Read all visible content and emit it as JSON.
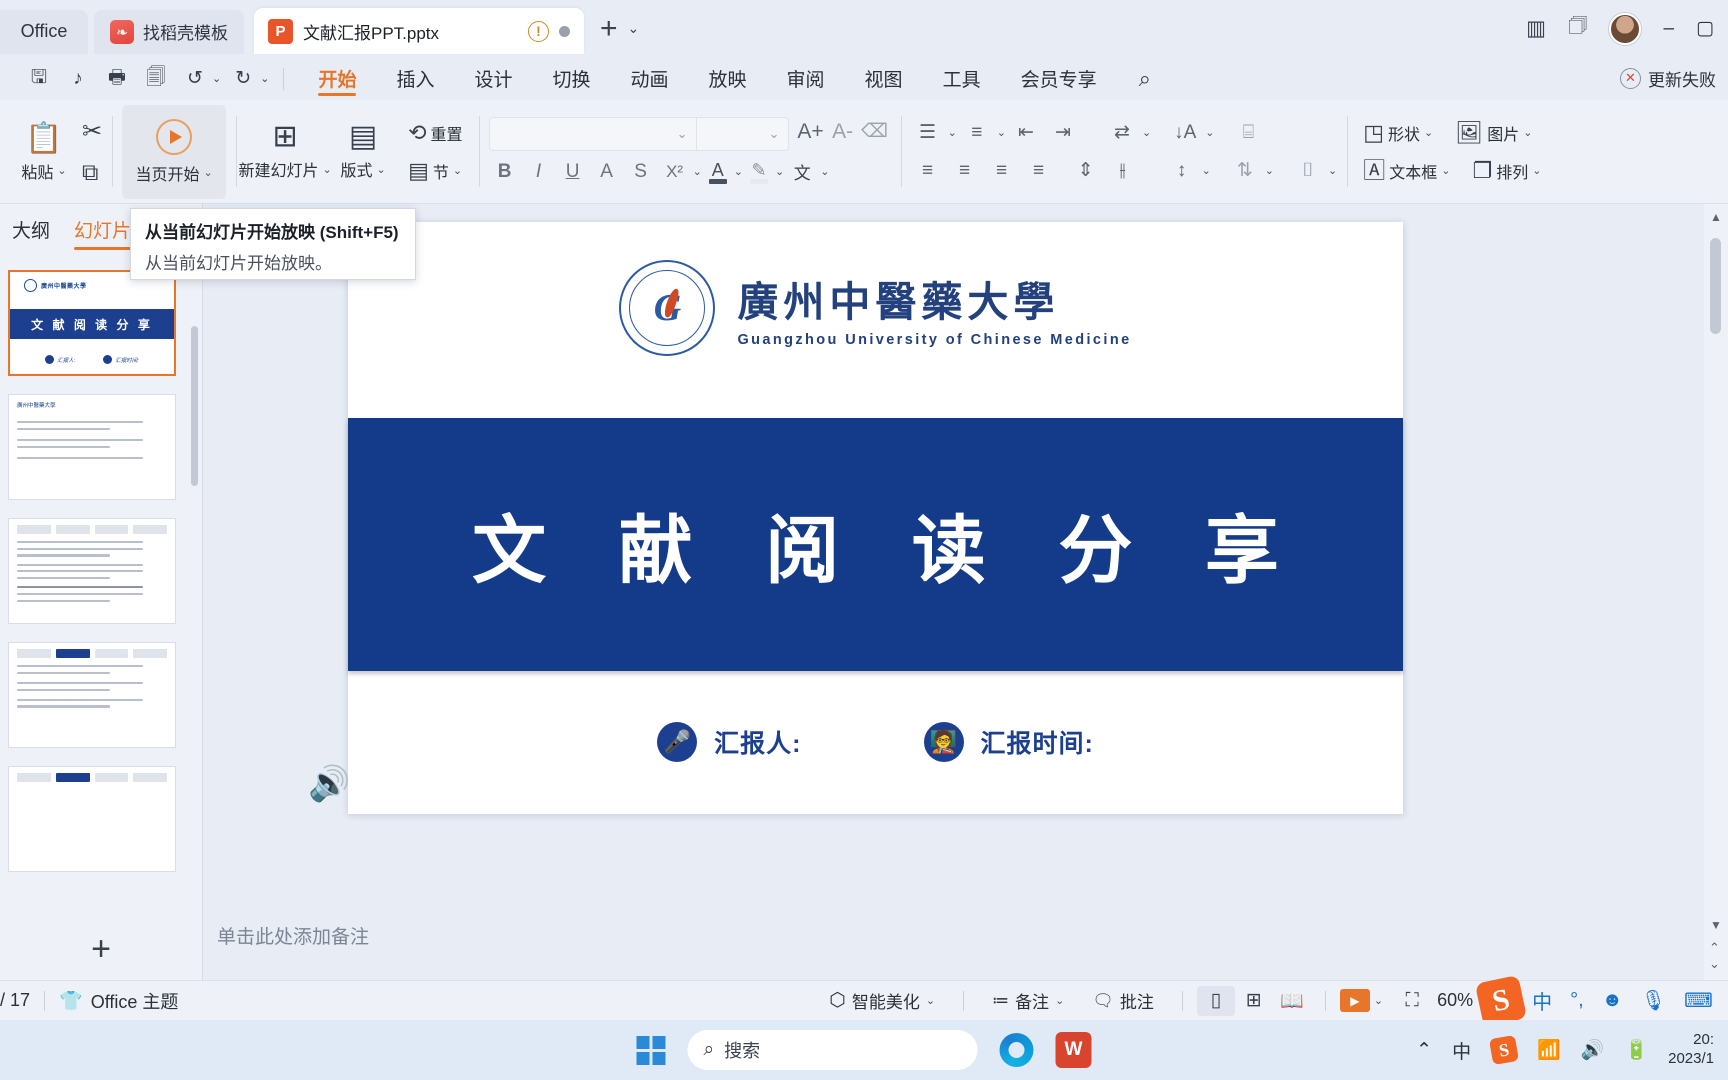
{
  "tabbar": {
    "office_label": "Office",
    "template_tab": "找稻壳模板",
    "template_icon": "leaf-icon",
    "doc_tab": "文献汇报PPT.pptx",
    "doc_icon": "powerpoint-file-icon",
    "warn_icon": "warning-icon",
    "status_dot": "unsaved-dot-icon",
    "new_tab": "+",
    "tab_menu_chevron": "⌄",
    "right_icons": [
      "sidebar-toggle-icon",
      "box-icon"
    ],
    "avatar": "user-avatar",
    "minimize": "–",
    "maximize": "▢"
  },
  "menubar": {
    "quick_access": [
      {
        "name": "save-icon",
        "glyph": "🖫"
      },
      {
        "name": "save-as-icon",
        "glyph": "♪"
      },
      {
        "name": "print-icon",
        "glyph": "🖶"
      },
      {
        "name": "print-preview-icon",
        "glyph": "🔍"
      },
      {
        "name": "undo-icon",
        "glyph": "↺"
      },
      {
        "name": "redo-icon",
        "glyph": "↻"
      }
    ],
    "items": [
      {
        "label": "开始",
        "active": true
      },
      {
        "label": "插入",
        "active": false
      },
      {
        "label": "设计",
        "active": false
      },
      {
        "label": "切换",
        "active": false
      },
      {
        "label": "动画",
        "active": false
      },
      {
        "label": "放映",
        "active": false
      },
      {
        "label": "审阅",
        "active": false
      },
      {
        "label": "视图",
        "active": false
      },
      {
        "label": "工具",
        "active": false
      },
      {
        "label": "会员专享",
        "active": false
      }
    ],
    "search_icon": "search-icon",
    "update_status": "更新失败",
    "update_icon": "update-failed-icon"
  },
  "ribbon": {
    "paste_label": "粘贴",
    "paste_icon": "clipboard-icon",
    "cut_icon": "scissors-icon",
    "copy_icon": "copy-icon",
    "current_start_label": "当页开始",
    "current_start_icon": "play-circle-icon",
    "new_slide_label": "新建幻灯片",
    "new_slide_icon": "new-slide-icon",
    "layout_label": "版式",
    "layout_icon": "layout-icon",
    "reset_label": "重置",
    "reset_icon": "reset-icon",
    "section_label": "节",
    "section_icon": "section-icon",
    "font_name": "",
    "font_size": "",
    "grow_font_icon": "A+",
    "shrink_font_icon": "A-",
    "clear_format_icon": "eraser-icon",
    "bold": "B",
    "italic": "I",
    "underline": "U",
    "strikeout": "A",
    "strike": "S",
    "superscript": "X²",
    "font_color": "A",
    "highlight": "✎",
    "pinyin": "文",
    "align_icons": [
      "align-left-icon",
      "align-center-icon",
      "align-right-icon",
      "align-justify-icon"
    ],
    "bullets_icon": "bullet-list-icon",
    "numbering_icon": "numbered-list-icon",
    "outdent_icon": "decrease-indent-icon",
    "indent_icon": "increase-indent-icon",
    "text_direction_icon": "text-direction-icon",
    "sort_icon": "sort-icon",
    "line_spacing_icon": "line-spacing-icon",
    "columns_icon": "columns-icon",
    "align_text_icon": "align-text-icon",
    "smartart_icon": "smartart-icon",
    "shape_label": "形状",
    "shape_icon": "shape-icon",
    "picture_label": "图片",
    "picture_icon": "picture-icon",
    "textbox_label": "文本框",
    "textbox_icon": "textbox-icon",
    "arrange_label": "排列",
    "arrange_icon": "arrange-icon"
  },
  "tooltip": {
    "title": "从当前幻灯片开始放映 (Shift+F5)",
    "body": "从当前幻灯片开始放映。"
  },
  "panel": {
    "tabs": [
      {
        "label": "大纲",
        "active": false
      },
      {
        "label": "幻灯片",
        "active": true
      }
    ],
    "add_slide_icon": "add-slide-plus-icon",
    "thumbnails": [
      {
        "type": "title",
        "selected": true,
        "title": "文 献 阅 读 分 享",
        "university": "廣州中醫藥大學",
        "foot": [
          "汇报人:",
          "汇报时间:"
        ]
      },
      {
        "type": "text",
        "selected": false
      },
      {
        "type": "text",
        "selected": false
      },
      {
        "type": "text",
        "selected": false
      },
      {
        "type": "text",
        "selected": false
      }
    ]
  },
  "slide": {
    "university_cn": "廣州中醫藥大學",
    "university_en": "Guangzhou University of Chinese Medicine",
    "seal_letter": "G",
    "seal_icon": "university-seal-icon",
    "title": "文 献 阅 读 分 享",
    "presenter_label": "汇报人:",
    "presenter_icon": "microphone-icon",
    "date_label": "汇报时间:",
    "date_icon": "presenter-board-icon",
    "audio_icon": "speaker-icon",
    "notes_placeholder": "单击此处添加备注",
    "accent_blue": "#133b8a",
    "title_blue": "#23417d"
  },
  "statusbar": {
    "page_indicator": "/ 17",
    "theme_label": "Office 主题",
    "theme_icon": "theme-icon",
    "beautify_label": "智能美化",
    "beautify_icon": "beautify-icon",
    "notes_label": "备注",
    "notes_icon": "notes-icon",
    "comment_label": "批注",
    "comment_icon": "comment-icon",
    "view_normal_icon": "normal-view-icon",
    "view_sorter_icon": "slide-sorter-icon",
    "view_reading_icon": "reading-view-icon",
    "play_icon": "play-slideshow-icon",
    "fit_icon": "fit-to-window-icon",
    "zoom_level": "60%",
    "ime_icons": [
      "sogou-logo-icon",
      "chinese-mode-icon",
      "punctuation-icon",
      "emoji-icon",
      "voice-icon",
      "keyboard-icon"
    ]
  },
  "taskbar": {
    "start_icon": "windows-start-icon",
    "search_placeholder": "搜索",
    "search_icon": "search-icon",
    "pinned": [
      "edge-icon",
      "wps-icon"
    ],
    "tray_chevron": "⌃",
    "tray_ime": "中",
    "tray_sogou": "sogou-tray-icon",
    "tray_wifi": "wifi-icon",
    "tray_volume": "volume-icon",
    "tray_battery": "battery-icon",
    "clock_time": "20:",
    "clock_date": "2023/1"
  }
}
